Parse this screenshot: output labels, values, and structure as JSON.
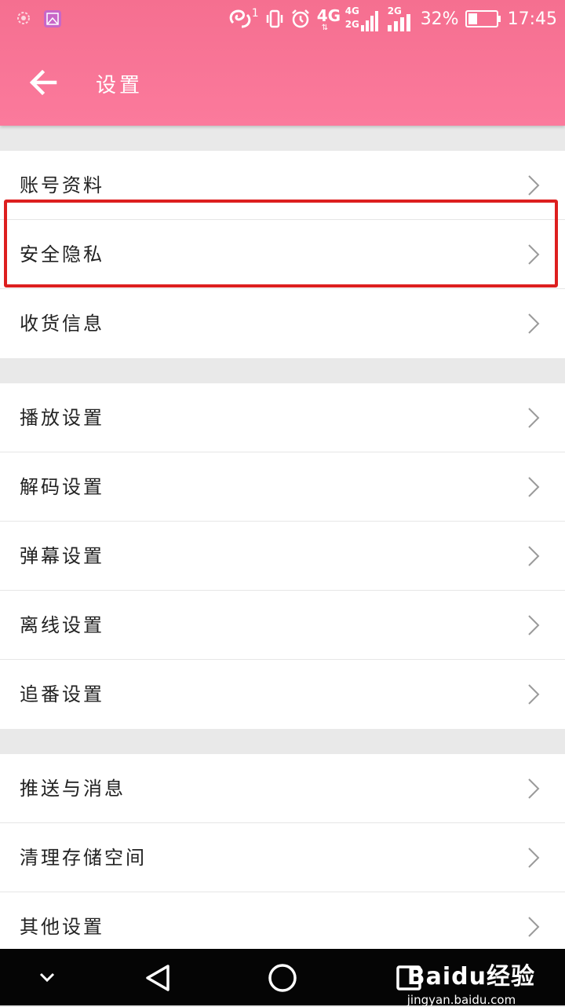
{
  "status_bar": {
    "sim_index": "1",
    "network_4g": "4G",
    "signal_4g": "4G",
    "signal_2g_left": "2G",
    "signal_2g_right": "2G",
    "battery_percent": "32%",
    "battery_level": 0.32,
    "time": "17:45"
  },
  "header": {
    "title": "设置"
  },
  "groups": [
    {
      "items": [
        {
          "label": "账号资料"
        },
        {
          "label": "安全隐私"
        },
        {
          "label": "收货信息"
        }
      ]
    },
    {
      "items": [
        {
          "label": "播放设置"
        },
        {
          "label": "解码设置"
        },
        {
          "label": "弹幕设置"
        },
        {
          "label": "离线设置"
        },
        {
          "label": "追番设置"
        }
      ]
    },
    {
      "items": [
        {
          "label": "推送与消息"
        },
        {
          "label": "清理存储空间"
        },
        {
          "label": "其他设置"
        }
      ]
    }
  ],
  "watermark": {
    "logo": "Baidu经验",
    "url": "jingyan.baidu.com"
  },
  "colors": {
    "header": "#fb7a9c",
    "highlight": "#dd1f1f"
  }
}
